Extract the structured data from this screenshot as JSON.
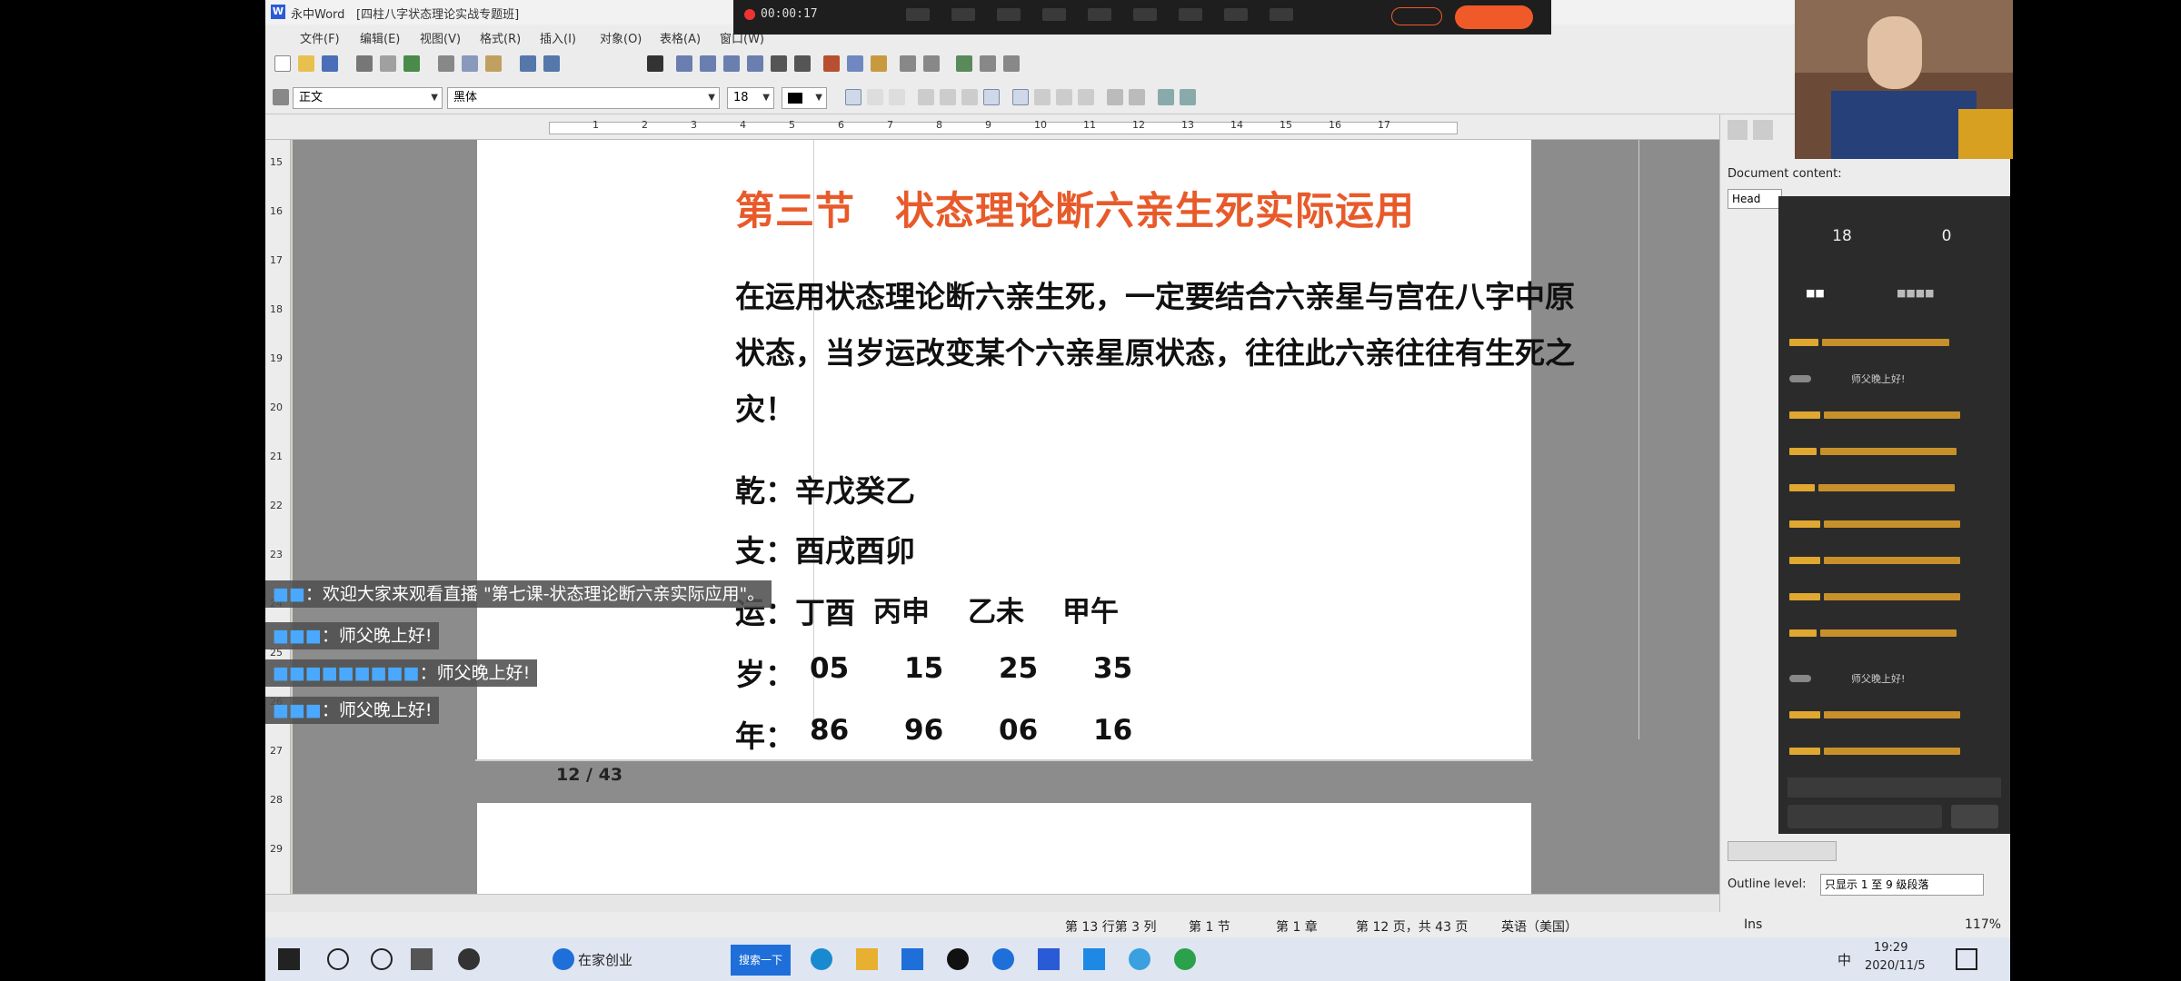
{
  "window": {
    "title": "[四柱八字状态理论实战专题班]"
  },
  "app": {
    "name": "永中Word"
  },
  "menu": [
    "文件(F)",
    "编辑(E)",
    "视图(V)",
    "格式(R)",
    "插入(I)",
    "对象(O)",
    "表格(A)",
    "窗口(W)"
  ],
  "live_overlay": {
    "timer": "00:00:17"
  },
  "format_bar": {
    "style": "正文",
    "font": "黑体",
    "size": "18"
  },
  "document": {
    "heading": "第三节　状态理论断六亲生死实际运用",
    "paragraph_lines": [
      "在运用状态理论断六亲生死，一定要结合六亲星与宫在八字中原",
      "状态，当岁运改变某个六亲星原状态，往往此六亲往往有生死之",
      "灾！"
    ],
    "qian": "乾：辛戊癸乙",
    "zhi": "支：酉戌酉卯",
    "yun_prefix": "运：丁酉",
    "yun_values": [
      "丙申",
      "乙未",
      "甲午"
    ],
    "sui_label": "岁：",
    "sui_values": [
      "05",
      "15",
      "25",
      "35"
    ],
    "nian_label": "年：",
    "nian_values": [
      "86",
      "96",
      "06",
      "16"
    ],
    "page_number": "12 / 43"
  },
  "chat_overlay": [
    {
      "user": "■■",
      "message": "：欢迎大家来观看直播 \"第七课-状态理论断六亲实际应用\"。"
    },
    {
      "user": "■■■",
      "message": "：师父晚上好!"
    },
    {
      "user": "■■■■■■■■■",
      "message": "：师父晚上好!"
    },
    {
      "user": "■■■",
      "message": "：师父晚上好!"
    }
  ],
  "ruler": {
    "labels": [
      "1",
      "2",
      "3",
      "4",
      "5",
      "6",
      "7",
      "8",
      "9",
      "10",
      "11",
      "12",
      "13",
      "14",
      "15",
      "16",
      "17"
    ]
  },
  "vruler": {
    "labels": [
      "15",
      "16",
      "17",
      "18",
      "19",
      "20",
      "21",
      "22",
      "23",
      "24",
      "25",
      "26",
      "27",
      "28",
      "29"
    ]
  },
  "side_panel": {
    "title": "Document content:",
    "heading_combo": "Head",
    "outline_label": "Outline level:",
    "outline_value": "只显示 1 至 9 级段落"
  },
  "live_panel": {
    "stat1_value": "18",
    "stat2_value": "0",
    "reply_placeholder": "",
    "chat_highlight": "师父晚上好!"
  },
  "statusbar": {
    "row_col": "第 13 行第 3 列",
    "section": "第 1 节",
    "chapter": "第 1 章",
    "pages": "第 12 页，共 43 页",
    "language": "英语（美国）",
    "ins": "Ins",
    "zoom": "117%"
  },
  "taskbar": {
    "search_item": "在家创业",
    "search_button": "搜索一下",
    "ime": "中",
    "time": "19:29",
    "date": "2020/11/5"
  },
  "colors": {
    "heading": "#e85a2a",
    "accent": "#2a5bd7",
    "live_end": "#f05a28"
  }
}
